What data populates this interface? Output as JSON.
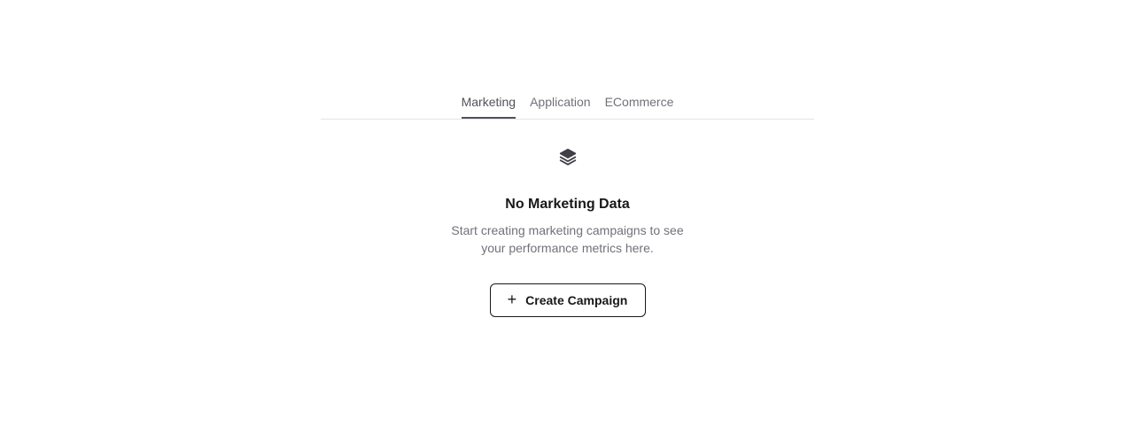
{
  "tabs": [
    {
      "label": "Marketing",
      "active": true
    },
    {
      "label": "Application",
      "active": false
    },
    {
      "label": "ECommerce",
      "active": false
    }
  ],
  "empty_state": {
    "icon": "layers-icon",
    "title": "No Marketing Data",
    "description": "Start creating marketing campaigns to see your performance metrics here.",
    "button_label": "Create Campaign",
    "button_icon": "plus-icon"
  },
  "colors": {
    "text_primary": "#18181b",
    "text_muted": "#71717a",
    "tab_active": "#52525b",
    "divider": "#e4e4e7"
  }
}
